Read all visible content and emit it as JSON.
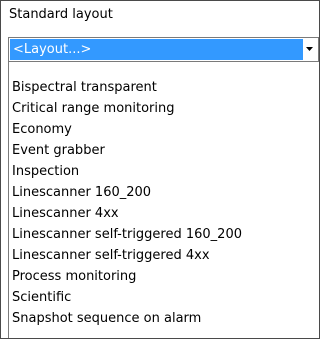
{
  "header": {
    "label": "Standard layout"
  },
  "combo": {
    "selected": "<Layout...>",
    "arrow_icon": "chevron-down-icon"
  },
  "list": {
    "items": [
      "Bispectral transparent",
      "Critical range monitoring",
      "Economy",
      "Event grabber",
      "Inspection",
      "Linescanner 160_200",
      "Linescanner 4xx",
      "Linescanner self-triggered 160_200",
      "Linescanner self-triggered 4xx",
      "Process monitoring",
      "Scientific",
      "Snapshot sequence on alarm"
    ]
  },
  "colors": {
    "highlight": "#3399ff",
    "highlight_text": "#ffffff",
    "border": "#7a7a7a"
  }
}
